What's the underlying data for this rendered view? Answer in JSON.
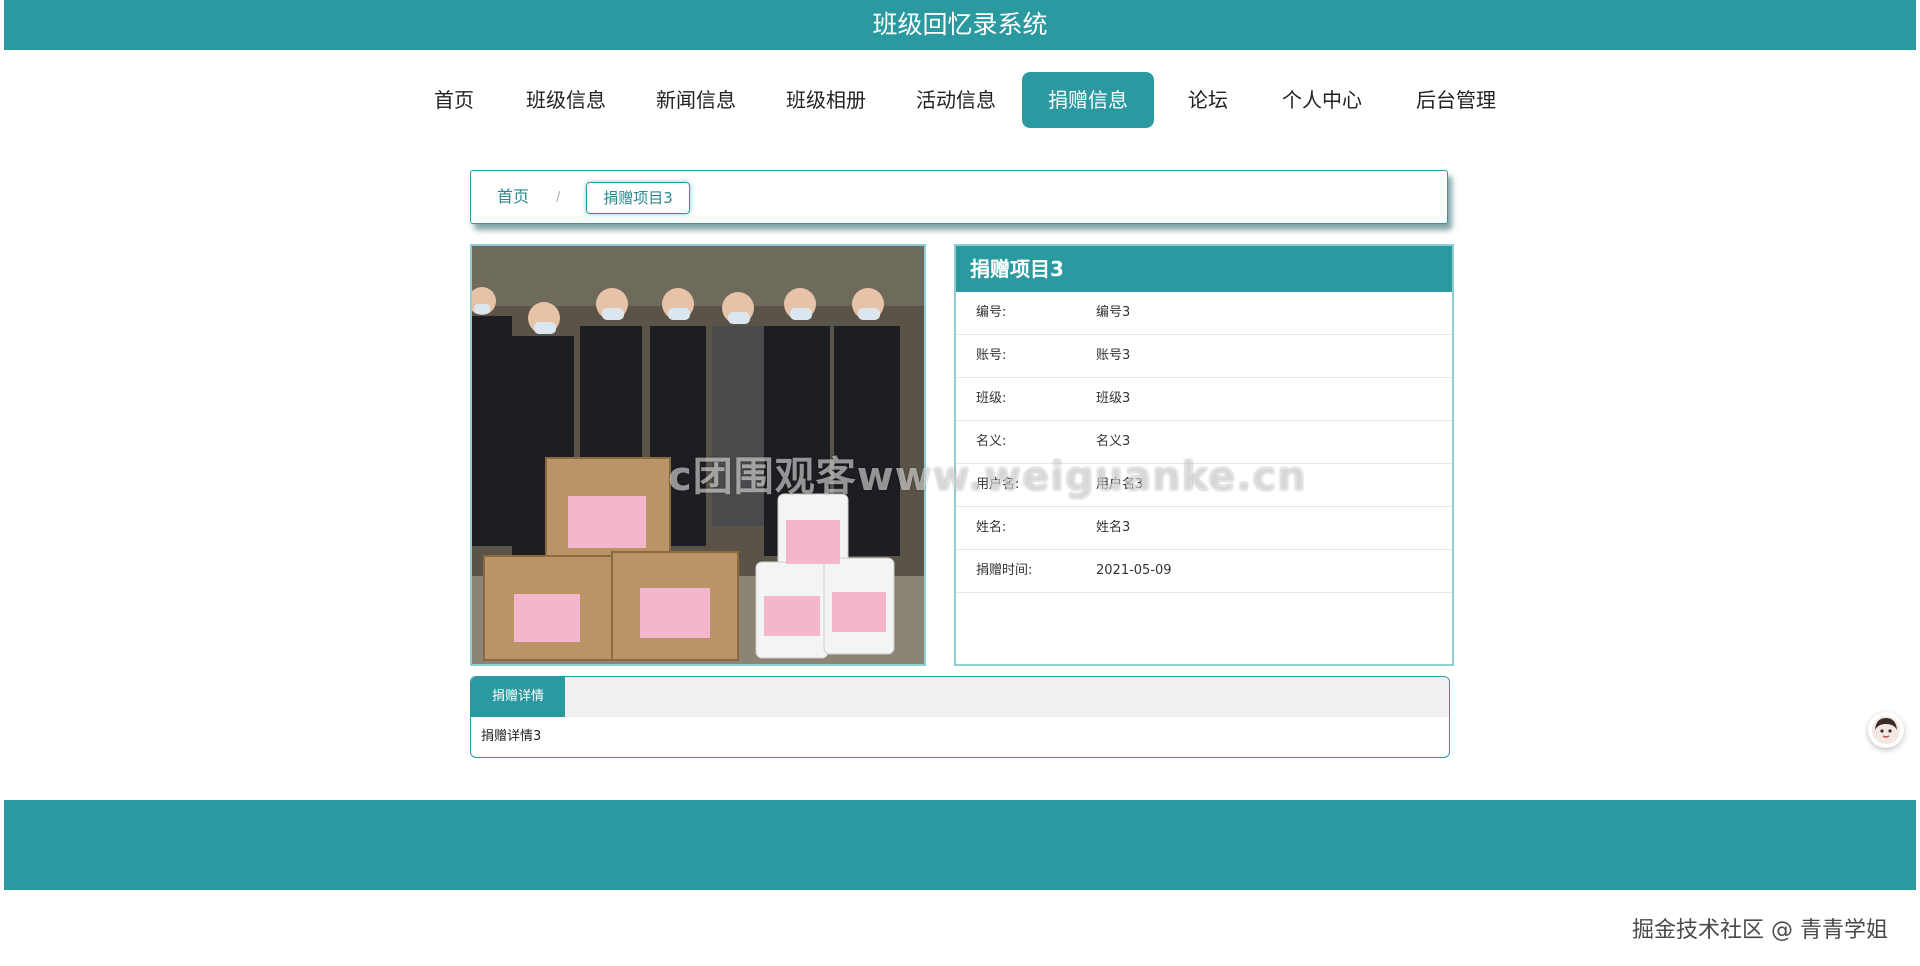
{
  "app": {
    "title": "班级回忆录系统"
  },
  "nav": {
    "items": [
      "首页",
      "班级信息",
      "新闻信息",
      "班级相册",
      "活动信息",
      "捐赠信息",
      "论坛",
      "个人中心",
      "后台管理"
    ],
    "active": "捐赠信息"
  },
  "breadcrumb": {
    "home": "首页",
    "separator": "/",
    "current": "捐赠项目3"
  },
  "photo": {
    "description_icon": "donation-photo"
  },
  "info": {
    "title": "捐赠项目3",
    "rows": [
      {
        "label": "编号:",
        "value": "编号3"
      },
      {
        "label": "账号:",
        "value": "账号3"
      },
      {
        "label": "班级:",
        "value": "班级3"
      },
      {
        "label": "名义:",
        "value": "名义3"
      },
      {
        "label": "用户名:",
        "value": "用户名3"
      },
      {
        "label": "姓名:",
        "value": "姓名3"
      },
      {
        "label": "捐赠时间:",
        "value": "2021-05-09"
      }
    ]
  },
  "detail": {
    "tab": "捐赠详情",
    "body": "捐赠详情3"
  },
  "overlay": {
    "watermark": "c团围观客www.weiguanke.cn",
    "credit": "掘金技术社区 @ 青青学姐"
  },
  "colors": {
    "primary": "#2a9aa0",
    "border_light": "#8cd0d3"
  }
}
